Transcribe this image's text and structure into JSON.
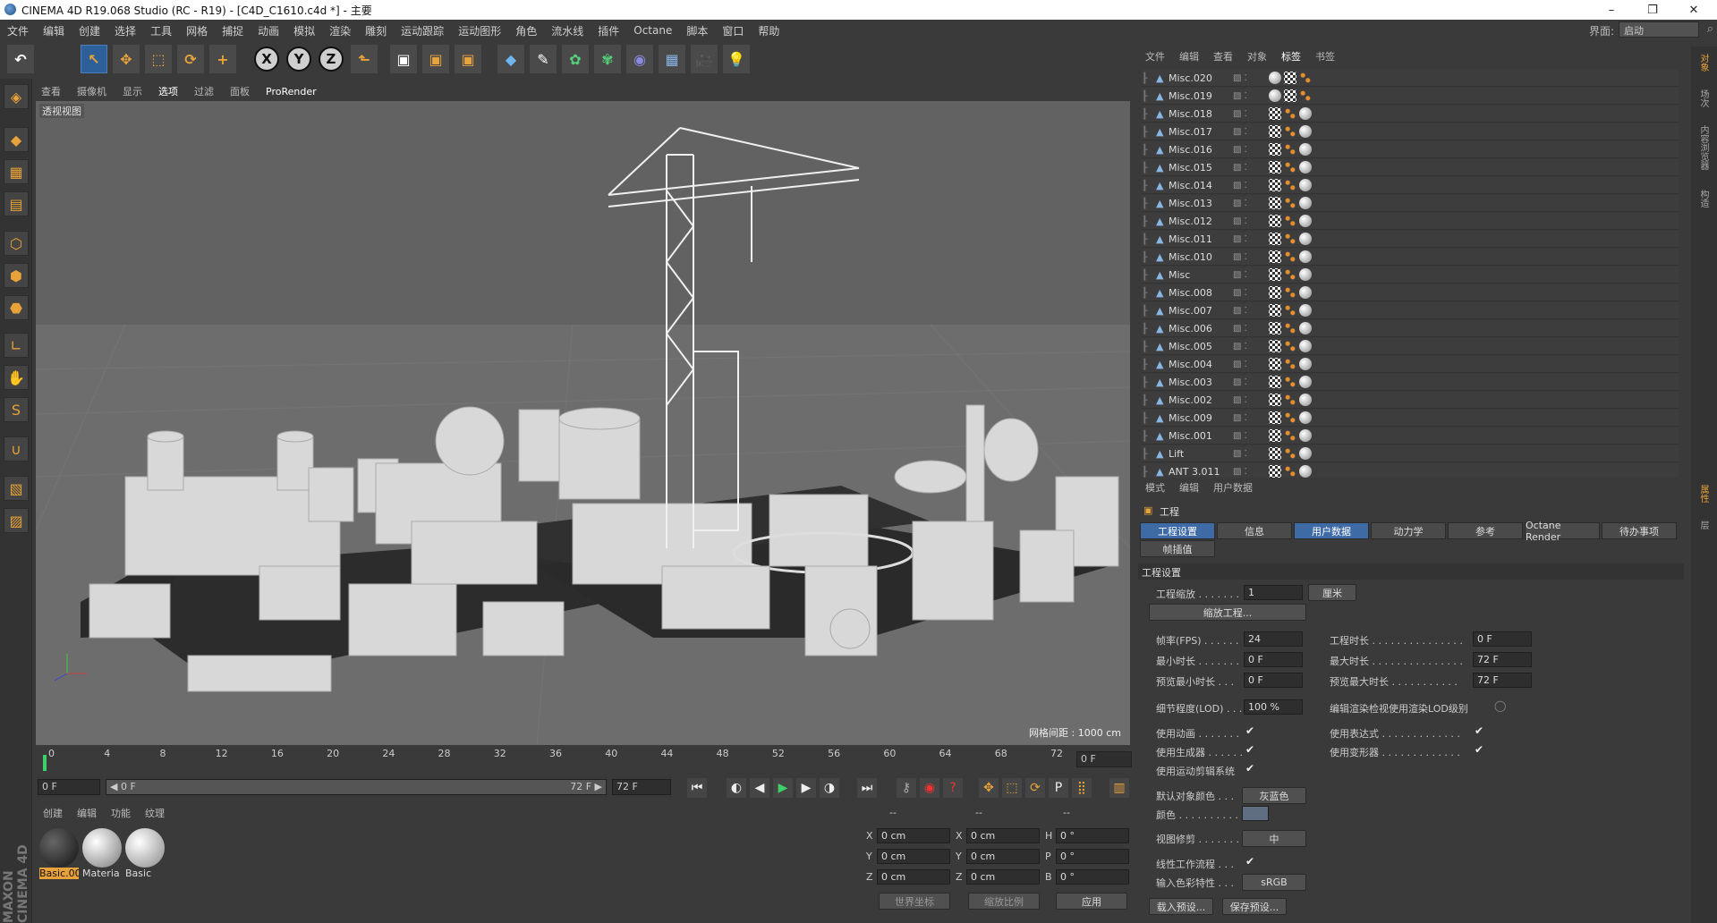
{
  "window": {
    "title": "CINEMA 4D R19.068 Studio (RC - R19) - [C4D_C1610.c4d *] - 主要",
    "minimize": "–",
    "maximize": "❐",
    "close": "✕"
  },
  "menu": [
    "文件",
    "编辑",
    "创建",
    "选择",
    "工具",
    "网格",
    "捕捉",
    "动画",
    "模拟",
    "渲染",
    "雕刻",
    "运动跟踪",
    "运动图形",
    "角色",
    "流水线",
    "插件",
    "Octane",
    "脚本",
    "窗口",
    "帮助"
  ],
  "layout": {
    "label": "界面:",
    "value": "启动"
  },
  "toolbar": {
    "undo": "↶",
    "select": "↖",
    "move": "✥",
    "scale": "⬚",
    "rotate": "⟳",
    "add": "+",
    "x": "X",
    "y": "Y",
    "z": "Z",
    "coord": "⬑",
    "render1": "▣",
    "render2": "▣",
    "render3": "▣",
    "cube": "◆",
    "pen": "✎",
    "gen": "✿",
    "deform": "✾",
    "field": "◉",
    "floor": "▦",
    "camera": "🎥",
    "light": "💡"
  },
  "viewport": {
    "menu": [
      "查看",
      "摄像机",
      "显示",
      "选项",
      "过滤",
      "面板",
      "ProRender"
    ],
    "active": "选项",
    "label": "透视视图",
    "grid": "网格间距 : 1000 cm"
  },
  "timeline": {
    "ticks": [
      "0",
      "4",
      "8",
      "12",
      "16",
      "20",
      "24",
      "28",
      "32",
      "36",
      "40",
      "44",
      "48",
      "52",
      "56",
      "60",
      "64",
      "68",
      "72"
    ],
    "frame": "0 F",
    "start": "0 F",
    "range_start": "◀ 0 F",
    "range_end": "72 F ▶",
    "end": "72 F"
  },
  "playback": {
    "first": "⏮",
    "prev_key": "◐",
    "prev": "◀",
    "play": "▶",
    "next": "▶",
    "next_key": "◑",
    "last": "⏭"
  },
  "materials": {
    "menu": [
      "创建",
      "编辑",
      "功能",
      "纹理"
    ],
    "items": [
      {
        "name": "Basic.00",
        "color": "#222"
      },
      {
        "name": "Materia",
        "color": "#bbb"
      },
      {
        "name": "Basic",
        "color": "#ccc"
      }
    ]
  },
  "coords": {
    "headers": [
      "--",
      "--",
      "--"
    ],
    "rows": [
      [
        "X",
        "0 cm",
        "X",
        "0 cm",
        "H",
        "0 °"
      ],
      [
        "Y",
        "0 cm",
        "Y",
        "0 cm",
        "P",
        "0 °"
      ],
      [
        "Z",
        "0 cm",
        "Z",
        "0 cm",
        "B",
        "0 °"
      ]
    ],
    "world": "世界坐标",
    "scale": "缩放比例",
    "apply": "应用"
  },
  "objects": {
    "menu": [
      "文件",
      "编辑",
      "查看",
      "对象",
      "标签",
      "书签"
    ],
    "items": [
      "Misc.020",
      "Misc.019",
      "Misc.018",
      "Misc.017",
      "Misc.016",
      "Misc.015",
      "Misc.014",
      "Misc.013",
      "Misc.012",
      "Misc.011",
      "Misc.010",
      "Misc",
      "Misc.008",
      "Misc.007",
      "Misc.006",
      "Misc.005",
      "Misc.004",
      "Misc.003",
      "Misc.002",
      "Misc.009",
      "Misc.001",
      "Lift",
      "ANT 3.011"
    ]
  },
  "attributes": {
    "menu": [
      "模式",
      "编辑",
      "用户数据"
    ],
    "title": "工程",
    "tabs": [
      "工程设置",
      "信息",
      "用户数据",
      "动力学",
      "参考",
      "Octane Render",
      "待办事项"
    ],
    "tab2": "帧插值",
    "section": "工程设置",
    "scale_lbl": "工程缩放 . . . . . . .",
    "scale_val": "1",
    "scale_unit": "厘米",
    "scale_btn": "缩放工程...",
    "fps_lbl": "帧率(FPS) . . . . . .",
    "fps": "24",
    "dur_lbl": "工程时长 . . . . . . . . . . . . . . .",
    "dur": "0 F",
    "min_lbl": "最小时长 . . . . . . .",
    "min": "0 F",
    "max_lbl": "最大时长 . . . . . . . . . . . . . . .",
    "max": "72 F",
    "pmin_lbl": "预览最小时长 . . .",
    "pmin": "0 F",
    "pmax_lbl": "预览最大时长 . . . . . . . . . . .",
    "pmax": "72 F",
    "lod_lbl": "细节程度(LOD) . . .",
    "lod": "100 %",
    "lod2_lbl": "编辑渲染检视使用渲染LOD级别",
    "anim_lbl": "使用动画 . . . . . . .",
    "expr_lbl": "使用表达式 . . . . . . . . . . . . .",
    "gen_lbl": "使用生成器 . . . . . .",
    "def_lbl": "使用变形器 . . . . . . . . . . . . .",
    "motion_lbl": "使用运动剪辑系统",
    "defcol_lbl": "默认对象颜色 . . .",
    "defcol": "灰蓝色",
    "color_lbl": "颜色 . . . . . . . . . .",
    "clip_lbl": "视图修剪 . . . . . . .",
    "clip": "中",
    "linear_lbl": "线性工作流程 . . .",
    "profile_lbl": "输入色彩特性 . . .",
    "profile": "sRGB",
    "load": "载入预设...",
    "save": "保存预设...",
    "check": "✔"
  },
  "right_tabs": [
    "对象",
    "场次",
    "内容浏览器",
    "构造",
    "属性",
    "层"
  ],
  "colors": {
    "accent": "#3e6aa6",
    "panel": "#3a3a3a",
    "viewport_bg": "#6a6a6a",
    "orange": "#e8a23a"
  }
}
